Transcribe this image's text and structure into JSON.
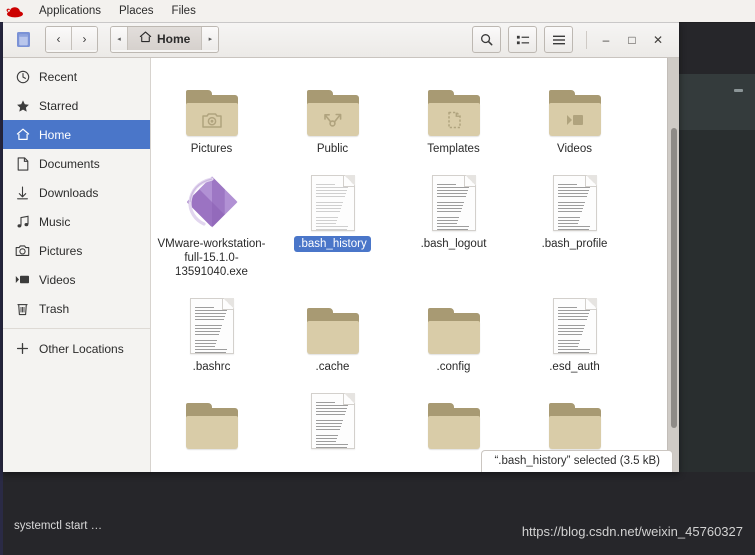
{
  "top_panel": {
    "logo": "redhat-logo",
    "items": [
      {
        "label": "Applications",
        "name": "applications-menu"
      },
      {
        "label": "Places",
        "name": "places-menu"
      },
      {
        "label": "Files",
        "name": "files-menu"
      }
    ]
  },
  "window": {
    "app_icon": "files-app-icon",
    "nav": {
      "back": "‹",
      "forward": "›"
    },
    "pathbar": {
      "left_arrow": "◂",
      "crumb": "Home",
      "crumb_icon": "home-icon",
      "right_arrow": "▸"
    },
    "tools": {
      "search": "search-icon",
      "view_list": "view-list-icon",
      "menu": "hamburger-menu-icon"
    },
    "controls": {
      "minimize": "–",
      "maximize": "□",
      "close": "✕"
    }
  },
  "sidebar": {
    "items": [
      {
        "label": "Recent",
        "icon": "clock-icon",
        "selected": false
      },
      {
        "label": "Starred",
        "icon": "star-icon",
        "selected": false
      },
      {
        "label": "Home",
        "icon": "home-icon",
        "selected": true
      },
      {
        "label": "Documents",
        "icon": "document-icon",
        "selected": false
      },
      {
        "label": "Downloads",
        "icon": "download-icon",
        "selected": false
      },
      {
        "label": "Music",
        "icon": "music-note-icon",
        "selected": false
      },
      {
        "label": "Pictures",
        "icon": "camera-icon",
        "selected": false
      },
      {
        "label": "Videos",
        "icon": "video-icon",
        "selected": false
      },
      {
        "label": "Trash",
        "icon": "trash-icon",
        "selected": false
      }
    ],
    "other_locations": {
      "label": "Other Locations",
      "icon": "plus-icon"
    }
  },
  "files": [
    {
      "label": "Pictures",
      "type": "folder",
      "emblem": "camera-icon",
      "selected": false
    },
    {
      "label": "Public",
      "type": "folder",
      "emblem": "share-icon",
      "selected": false
    },
    {
      "label": "Templates",
      "type": "folder",
      "emblem": "template-icon",
      "selected": false
    },
    {
      "label": "Videos",
      "type": "folder",
      "emblem": "video-icon",
      "selected": false
    },
    {
      "label": "VMware-workstation-full-15.1.0-13591040.exe",
      "type": "exe",
      "selected": false
    },
    {
      "label": ".bash_history",
      "type": "doc-faint",
      "selected": true
    },
    {
      "label": ".bash_logout",
      "type": "doc",
      "selected": false
    },
    {
      "label": ".bash_profile",
      "type": "doc",
      "selected": false
    },
    {
      "label": ".bashrc",
      "type": "doc",
      "selected": false
    },
    {
      "label": ".cache",
      "type": "folder",
      "emblem": "",
      "selected": false
    },
    {
      "label": ".config",
      "type": "folder",
      "emblem": "",
      "selected": false
    },
    {
      "label": ".esd_auth",
      "type": "doc",
      "selected": false
    },
    {
      "label": "",
      "type": "folder",
      "emblem": "",
      "selected": false
    },
    {
      "label": "",
      "type": "doc",
      "selected": false
    },
    {
      "label": "",
      "type": "folder",
      "emblem": "",
      "selected": false
    },
    {
      "label": "",
      "type": "folder",
      "emblem": "",
      "selected": false
    }
  ],
  "status_overlay": {
    "text": "“.bash_history” selected  (3.5 kB)"
  },
  "desktop": {
    "terminal_text": "systemctl start …",
    "watermark": "https://blog.csdn.net/weixin_45760327"
  },
  "colors": {
    "selection_blue": "#4a76c9",
    "folder_body": "#d9cca8",
    "folder_tab": "#a89a73",
    "panel_bg": "#f3f1ee",
    "desktop_bg": "#26262a",
    "redhat_red": "#cc0000"
  }
}
